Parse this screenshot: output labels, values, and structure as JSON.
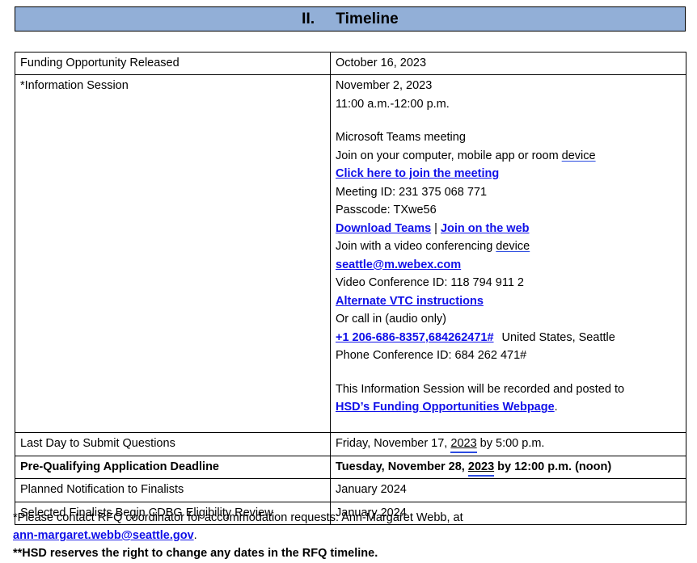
{
  "header": {
    "number": "II.",
    "title": "Timeline",
    "fill_color": "#92AFD7"
  },
  "colors": {
    "header_fill": "#92AFD7",
    "link": "#1010E8",
    "grammar_underline": "#2B4BE0",
    "text": "#000000",
    "border": "#000000"
  },
  "table": {
    "rows": [
      {
        "label": "Funding Opportunity Released",
        "value": "October 16, 2023"
      },
      {
        "label": "*Information Session",
        "session": {
          "date": "November 2, 2023",
          "time": "11:00 a.m.-12:00 p.m.",
          "meeting_type": "Microsoft Teams meeting",
          "join_intro_text": "Join on your computer, mobile app or room ",
          "join_intro_device": "device",
          "join_link": "Click here to join the meeting",
          "meeting_id": "Meeting ID: 231 375 068 771",
          "passcode": "Passcode: TXwe56",
          "download_teams": "Download Teams",
          "separator": "|",
          "join_web": "Join on the web",
          "vtc_intro_text": "Join with a video conferencing ",
          "vtc_intro_device": "device",
          "webex_email": "seattle@m.webex.com",
          "video_conference_id": "Video Conference ID: 118 794 911 2",
          "alternate_vtc": "Alternate VTC instructions",
          "call_in_label": "Or call in (audio only)",
          "phone_number": "+1 206-686-8357,684262471#",
          "phone_location": "United States, Seattle",
          "phone_conference_id": "Phone Conference ID: 684 262 471#",
          "recording_notice": "This Information Session will be recorded and posted to ",
          "recording_link": "HSD’s Funding Opportunities Webpage",
          "recording_period": "."
        }
      },
      {
        "label": "Last Day to Submit Questions",
        "value_prefix": "Friday, November 17, ",
        "value_year": "2023",
        "value_suffix": " by 5:00 p.m."
      },
      {
        "label": "Pre-Qualifying Application Deadline",
        "value_prefix": "Tuesday, November 28, ",
        "value_year": "2023",
        "value_suffix": " by 12:00 p.m. (noon)",
        "bold": true
      },
      {
        "label": "Planned Notification to Finalists",
        "value": "January 2024"
      },
      {
        "label": "Selected Finalists Begin CDBG Eligibility Review",
        "value": "January 2024"
      }
    ]
  },
  "footer": {
    "note1_text": "*Please contact RFQ coordinator for accommodation requests: Ann-Margaret Webb, at",
    "note1_email": "ann-margaret.webb@seattle.gov",
    "note1_period": ".",
    "note2": "**HSD reserves the right to change any dates in the RFQ timeline."
  }
}
